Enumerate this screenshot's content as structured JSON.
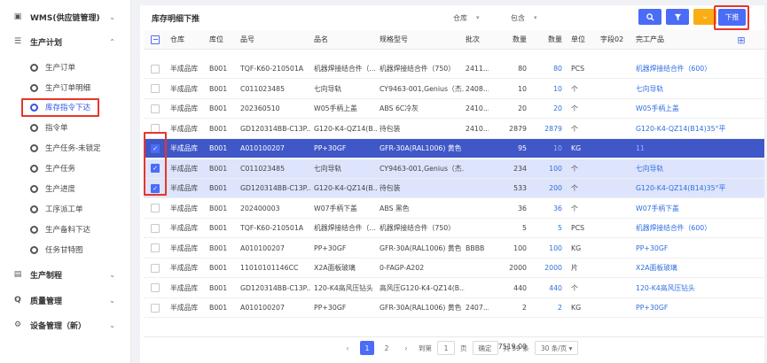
{
  "sidebar": {
    "groups": [
      {
        "label": "WMS(供应链管理)",
        "icon": "box-icon",
        "glyph": "▣",
        "state": "collapsed"
      },
      {
        "label": "生产计划",
        "icon": "sliders-icon",
        "glyph": "☰",
        "state": "expanded"
      },
      {
        "label": "生产制程",
        "icon": "layers-icon",
        "glyph": "▤",
        "state": "collapsed"
      },
      {
        "label": "质量管理",
        "icon": "magnifier-icon",
        "glyph": "Q",
        "state": "collapsed"
      },
      {
        "label": "设备管理（新）",
        "icon": "gear-icon",
        "glyph": "⚙",
        "state": "collapsed"
      }
    ],
    "items": [
      {
        "label": "生产订单"
      },
      {
        "label": "生产订单明细"
      },
      {
        "label": "库存指令下达",
        "active": true
      },
      {
        "label": "指令单"
      },
      {
        "label": "生产任务-未锁定"
      },
      {
        "label": "生产任务"
      },
      {
        "label": "生产进度"
      },
      {
        "label": "工序派工单"
      },
      {
        "label": "生产备料下达"
      },
      {
        "label": "任务甘特图"
      }
    ]
  },
  "toolbar": {
    "title": "库存明细下推",
    "filter_field": "仓库",
    "filter_op": "包含",
    "push_label": "下推"
  },
  "table": {
    "columns": [
      "仓库",
      "库位",
      "品号",
      "品名",
      "规格型号",
      "批次",
      "数量",
      "数量",
      "单位",
      "字段02",
      "完工产品"
    ],
    "rows": [
      {
        "wh": "半成品库",
        "loc": "B001",
        "code": "TQF-K60-210501A",
        "name": "机器焊接结合件（...",
        "spec": "机器焊接结合件（750）",
        "batch": "2411...",
        "qty": "80",
        "qty2": "80",
        "unit": "PCS",
        "f02": "",
        "prod": "机器焊接结合件（600）",
        "state": "normal"
      },
      {
        "wh": "半成品库",
        "loc": "B001",
        "code": "C011023485",
        "name": "七向导轨",
        "spec": "CY9463-001,Genius（杰...",
        "batch": "2408...",
        "qty": "10",
        "qty2": "10",
        "unit": "个",
        "f02": "",
        "prod": "七向导轨",
        "state": "normal"
      },
      {
        "wh": "半成品库",
        "loc": "B001",
        "code": "202360510",
        "name": "W05手柄上盖",
        "spec": "ABS 6C冷灰",
        "batch": "2410...",
        "qty": "20",
        "qty2": "20",
        "unit": "个",
        "f02": "",
        "prod": "W05手柄上盖",
        "state": "normal"
      },
      {
        "wh": "半成品库",
        "loc": "B001",
        "code": "GD120314BB-C13P...",
        "name": "G120-K4-QZ14(B...",
        "spec": "待包装",
        "batch": "2410...",
        "qty": "2879",
        "qty2": "2879",
        "unit": "个",
        "f02": "",
        "prod": "G120-K4-QZ14(B14)35°平",
        "state": "normal"
      },
      {
        "wh": "半成品库",
        "loc": "B001",
        "code": "A010100207",
        "name": "PP+30GF",
        "spec": "GFR-30A(RAL1006) 黄色",
        "batch": "",
        "qty": "95",
        "qty2": "10",
        "unit": "KG",
        "f02": "",
        "prod": "11",
        "state": "focus"
      },
      {
        "wh": "半成品库",
        "loc": "B001",
        "code": "C011023485",
        "name": "七向导轨",
        "spec": "CY9463-001,Genius（杰...",
        "batch": "",
        "qty": "234",
        "qty2": "100",
        "unit": "个",
        "f02": "",
        "prod": "七向导轨",
        "state": "sel"
      },
      {
        "wh": "半成品库",
        "loc": "B001",
        "code": "GD120314BB-C13P...",
        "name": "G120-K4-QZ14(B...",
        "spec": "待包装",
        "batch": "",
        "qty": "533",
        "qty2": "200",
        "unit": "个",
        "f02": "",
        "prod": "G120-K4-QZ14(B14)35°平",
        "state": "sel"
      },
      {
        "wh": "半成品库",
        "loc": "B001",
        "code": "202400003",
        "name": "W07手柄下盖",
        "spec": "ABS 黑色",
        "batch": "",
        "qty": "36",
        "qty2": "36",
        "unit": "个",
        "f02": "",
        "prod": "W07手柄下盖",
        "state": "normal"
      },
      {
        "wh": "半成品库",
        "loc": "B001",
        "code": "TQF-K60-210501A",
        "name": "机器焊接结合件（...",
        "spec": "机器焊接结合件（750）",
        "batch": "",
        "qty": "5",
        "qty2": "5",
        "unit": "PCS",
        "f02": "",
        "prod": "机器焊接结合件（600）",
        "state": "normal"
      },
      {
        "wh": "半成品库",
        "loc": "B001",
        "code": "A010100207",
        "name": "PP+30GF",
        "spec": "GFR-30A(RAL1006) 黄色",
        "batch": "BBBB",
        "qty": "100",
        "qty2": "100",
        "unit": "KG",
        "f02": "",
        "prod": "PP+30GF",
        "state": "normal"
      },
      {
        "wh": "半成品库",
        "loc": "B001",
        "code": "11010101146CC",
        "name": "X2A面板玻璃",
        "spec": "0-FAGP-A202",
        "batch": "",
        "qty": "2000",
        "qty2": "2000",
        "unit": "片",
        "f02": "",
        "prod": "X2A面板玻璃",
        "state": "normal"
      },
      {
        "wh": "半成品库",
        "loc": "B001",
        "code": "GD120314BB-C13P...",
        "name": "120-K4高风压钻头",
        "spec": "高风压G120-K4-QZ14(B...",
        "batch": "",
        "qty": "440",
        "qty2": "440",
        "unit": "个",
        "f02": "",
        "prod": "120-K4高风压钻头",
        "state": "normal"
      },
      {
        "wh": "半成品库",
        "loc": "B001",
        "code": "A010100207",
        "name": "PP+30GF",
        "spec": "GFR-30A(RAL1006) 黄色",
        "batch": "2407...",
        "qty": "2",
        "qty2": "2",
        "unit": "KG",
        "f02": "",
        "prod": "PP+30GF",
        "state": "normal"
      }
    ],
    "total": "7519.00"
  },
  "pager": {
    "prev": "‹",
    "pages": [
      "1",
      "2"
    ],
    "next": "›",
    "goto_label": "到第",
    "goto_value": "1",
    "page_unit": "页",
    "confirm": "确定",
    "total_text": "共 59 条",
    "page_size": "30 条/页"
  }
}
